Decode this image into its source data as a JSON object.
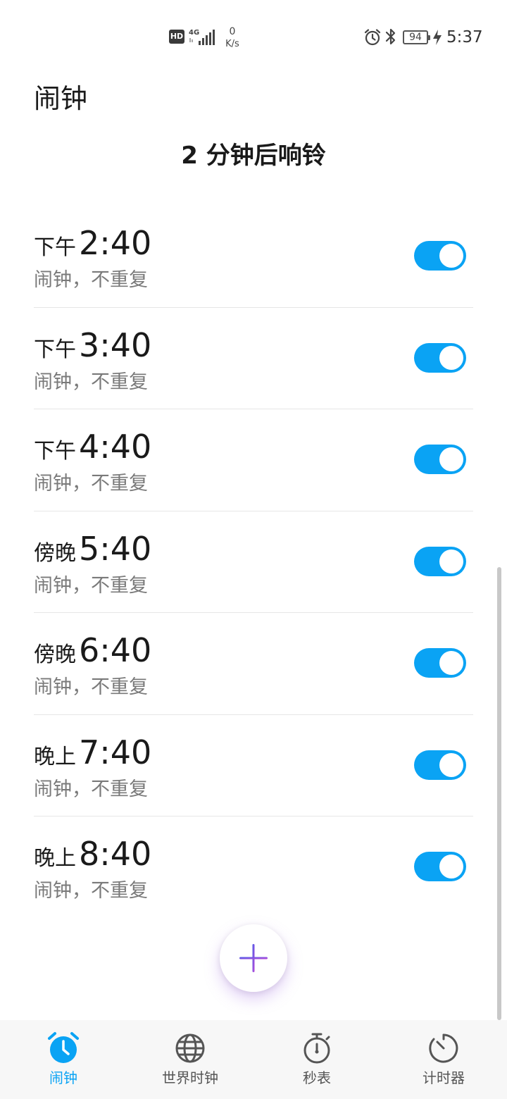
{
  "status_bar": {
    "hd_label": "HD",
    "net_label": "4G",
    "net_speed_value": "0",
    "net_speed_unit": "K/s",
    "battery_level": "94",
    "time": "5:37"
  },
  "header": {
    "title": "闹钟",
    "next_alarm": "2 分钟后响铃"
  },
  "alarms": [
    {
      "period": "下午",
      "time": "2:40",
      "desc": "闹钟，不重复",
      "enabled": true
    },
    {
      "period": "下午",
      "time": "3:40",
      "desc": "闹钟，不重复",
      "enabled": true
    },
    {
      "period": "下午",
      "time": "4:40",
      "desc": "闹钟，不重复",
      "enabled": true
    },
    {
      "period": "傍晚",
      "time": "5:40",
      "desc": "闹钟，不重复",
      "enabled": true
    },
    {
      "period": "傍晚",
      "time": "6:40",
      "desc": "闹钟，不重复",
      "enabled": true
    },
    {
      "period": "晚上",
      "time": "7:40",
      "desc": "闹钟，不重复",
      "enabled": true
    },
    {
      "period": "晚上",
      "time": "8:40",
      "desc": "闹钟，不重复",
      "enabled": true
    }
  ],
  "fab": {
    "icon": "plus-icon"
  },
  "bottom_nav": [
    {
      "label": "闹钟",
      "icon": "alarm-clock-icon",
      "active": true
    },
    {
      "label": "世界时钟",
      "icon": "globe-icon",
      "active": false
    },
    {
      "label": "秒表",
      "icon": "stopwatch-icon",
      "active": false
    },
    {
      "label": "计时器",
      "icon": "timer-icon",
      "active": false
    }
  ],
  "colors": {
    "accent": "#0aa3f4",
    "text_primary": "#1a1a1a",
    "text_secondary": "#7a7a7a",
    "nav_background": "#f7f7f7",
    "fab_plus_start": "#4a5be8",
    "fab_plus_end": "#c04bd8"
  }
}
